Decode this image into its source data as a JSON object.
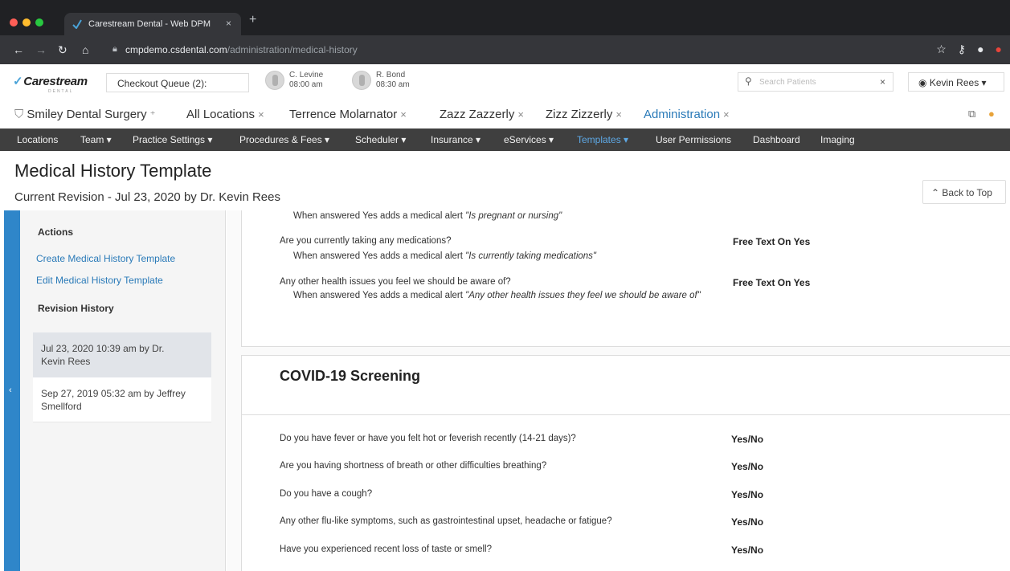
{
  "browser": {
    "tab_title": "Carestream Dental - Web DPM",
    "tab_close": "×",
    "new_tab": "+",
    "url_host": "cmpdemo.csdental.com",
    "url_path": "/administration/medical-history",
    "window_controls": [
      "#ff5f57",
      "#febc2e",
      "#28c840"
    ]
  },
  "header": {
    "logo": "Carestream",
    "logo_sub": "DENTAL",
    "checkout_queue": "Checkout Queue (2):",
    "appointments": [
      {
        "name": "C. Levine",
        "time": "08:00 am"
      },
      {
        "name": "R. Bond",
        "time": "08:30 am"
      }
    ],
    "search_placeholder": "Search Patients",
    "search_clear": "×",
    "user_name": "Kevin Rees"
  },
  "work_tabs": [
    {
      "label": "Smiley Dental Surgery",
      "close": "⁺"
    },
    {
      "label": "All Locations",
      "close": "×"
    },
    {
      "label": "Terrence Molarnator",
      "close": "×"
    },
    {
      "label": "Zazz Zazzerly",
      "close": "×"
    },
    {
      "label": "Zizz Zizzerly",
      "close": "×"
    },
    {
      "label": "Administration",
      "close": "×",
      "active": true
    }
  ],
  "menu": [
    {
      "label": "Locations"
    },
    {
      "label": "Team ▾"
    },
    {
      "label": "Practice Settings ▾"
    },
    {
      "label": "Procedures & Fees ▾"
    },
    {
      "label": "Scheduler ▾"
    },
    {
      "label": "Insurance ▾"
    },
    {
      "label": "eServices ▾"
    },
    {
      "label": "Templates ▾",
      "selected": true
    },
    {
      "label": "User Permissions"
    },
    {
      "label": "Dashboard"
    },
    {
      "label": "Imaging"
    }
  ],
  "page": {
    "title": "Medical History Template",
    "subtitle": "Current Revision - Jul 23, 2020 by Dr. Kevin Rees",
    "back_to_top": "Back to Top"
  },
  "sidebar": {
    "actions_heading": "Actions",
    "create_link": "Create Medical History Template",
    "edit_link": "Edit Medical History Template",
    "revision_heading": "Revision History",
    "revisions": [
      {
        "line1": "Jul 23, 2020 10:39 am by Dr.",
        "line2": "Kevin Rees"
      },
      {
        "line1": "Sep 27, 2019 05:32 am by Jeffrey",
        "line2": "Smellford"
      }
    ]
  },
  "medical_section": {
    "items": [
      {
        "question": "",
        "alert_prefix": "When answered Yes adds a medical alert ",
        "alert_text": "\"Is pregnant or nursing\"",
        "answer": ""
      },
      {
        "question": "Are you currently taking any medications?",
        "alert_prefix": "When answered Yes adds a medical alert ",
        "alert_text": "\"Is currently taking medications\"",
        "answer": "Free Text On Yes"
      },
      {
        "question": "Any other health issues you feel we should be aware of?",
        "alert_prefix": "When answered Yes adds a medical alert ",
        "alert_text": "\"Any other health issues they feel we should be aware of\"",
        "answer": "Free Text On Yes"
      }
    ]
  },
  "covid_section": {
    "title": "COVID-19 Screening",
    "questions": [
      {
        "question": "Do you have fever or have you felt hot or feverish recently (14-21 days)?",
        "answer": "Yes/No"
      },
      {
        "question": "Are you having shortness of breath or other difficulties breathing?",
        "answer": "Yes/No"
      },
      {
        "question": "Do you have a cough?",
        "answer": "Yes/No"
      },
      {
        "question": "Any other flu-like symptoms, such as gastrointestinal upset, headache or fatigue?",
        "answer": "Yes/No"
      },
      {
        "question": "Have you experienced recent loss of taste or smell?",
        "answer": "Yes/No"
      }
    ]
  },
  "colors": {
    "accent": "#2f86c9",
    "link": "#2a7ab8",
    "menubar": "#3f3f3f"
  }
}
